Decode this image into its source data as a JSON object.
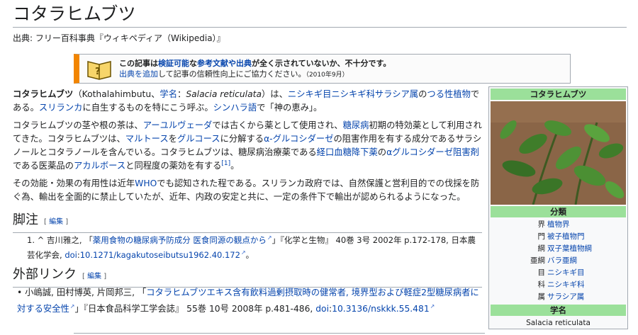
{
  "article": {
    "title": "コタラヒムブツ",
    "from": "出典: フリー百科事典『ウィキペディア（Wikipedia）』"
  },
  "ambox": {
    "l1_a": "この記事は",
    "l1_b": "検証可能",
    "l1_c": "な",
    "l1_d": "参考文献や出典",
    "l1_e": "が全く示されていないか、不十分です。",
    "l2_a": "出典を追加",
    "l2_b": "して記事の信頼性向上にご協力ください。",
    "l2_c": "（2010年9月）"
  },
  "intro": {
    "p1": [
      {
        "t": "コタラヒムブツ",
        "b": true
      },
      {
        "t": "（Kothalahimbutu、"
      },
      {
        "t": "学名",
        "link": true
      },
      {
        "t": "：",
        "i": false
      },
      {
        "t": "Salacia reticulata",
        "i": true
      },
      {
        "t": "）は、"
      },
      {
        "t": "ニシキギ目ニシキギ科サラシア属",
        "link": true
      },
      {
        "t": "の"
      },
      {
        "t": "つる性植物",
        "link": true
      },
      {
        "t": "である。"
      },
      {
        "t": "スリランカ",
        "link": true
      },
      {
        "t": "に自生するものを特にこう呼ぶ。"
      },
      {
        "t": "シンハラ語",
        "link": true
      },
      {
        "t": "で「神の恵み」。"
      }
    ],
    "p2": [
      {
        "t": "コタラヒムブツの茎や根の茶は、"
      },
      {
        "t": "アーユルヴェーダ",
        "link": true
      },
      {
        "t": "では古くから薬として使用され、"
      },
      {
        "t": "糖尿病",
        "link": true
      },
      {
        "t": "初期の特効薬として利用されてきた。コタラヒムブツは、"
      },
      {
        "t": "マルトース",
        "link": true
      },
      {
        "t": "を"
      },
      {
        "t": "グルコース",
        "link": true
      },
      {
        "t": "に分解する"
      },
      {
        "t": "α-グルコシダーゼ",
        "link": true
      },
      {
        "t": "の阻害作用を有する成分であるサラシノールとコタラノールを含んでいる。コタラヒムブツは、糖尿病治療薬である"
      },
      {
        "t": "経口血糖降下薬",
        "link": true
      },
      {
        "t": "の"
      },
      {
        "t": "αグルコシダーゼ阻害剤",
        "link": true
      },
      {
        "t": "である医薬品の"
      },
      {
        "t": "アカルボース",
        "link": true
      },
      {
        "t": "と同程度の薬効を有する"
      },
      {
        "t": "[1]",
        "link": true,
        "sup": true
      },
      {
        "t": "。"
      }
    ],
    "p3": [
      {
        "t": "その効能・効果の有用性は近年"
      },
      {
        "t": "WHO",
        "link": true
      },
      {
        "t": "でも認知された程である。スリランカ政府では、自然保護と営利目的での伐採を防ぐ為、輸出を全面的に禁止していたが、近年、内政の安定と共に、一定の条件下で輸出が認められるようになった。"
      }
    ]
  },
  "sections": {
    "notes_title": "脚注",
    "ext_title": "外部リンク",
    "edit_open": "[",
    "edit_label": "編集",
    "edit_close": "]"
  },
  "notes": [
    [
      {
        "t": "1. ^ "
      },
      {
        "t": "吉川雅之, 「"
      },
      {
        "t": "薬用食物の糖尿病予防成分 医食同源の観点から",
        "link": true,
        "ext": true
      },
      {
        "t": "」『化学と生物』 40巻 3号 2002年 p.172-178, 日本農芸化学会, "
      },
      {
        "t": "doi",
        "link": true
      },
      {
        "t": ":"
      },
      {
        "t": "10.1271/kagakutoseibutsu1962.40.172",
        "link": true,
        "ext": true
      },
      {
        "t": "。"
      }
    ]
  ],
  "ext_links": [
    [
      {
        "t": "• 小嶋誠, 田村博英, 片岡邦三, 「"
      },
      {
        "t": "コタラヒムブツエキス含有飲料過剰摂取時の健常者, 境界型および軽症2型糖尿病者に対する安全性",
        "link": true,
        "ext": true
      },
      {
        "t": "」『日本食品科学工学会誌』 55巻 10号 2008年 p.481-486, "
      },
      {
        "t": "doi",
        "link": true
      },
      {
        "t": ":"
      },
      {
        "t": "10.3136/nskkk.55.481",
        "link": true,
        "ext": true
      }
    ]
  ],
  "infobox": {
    "title": "コタラヒムブツ",
    "class_header": "分類",
    "rows": [
      {
        "k": "界",
        "v": "植物界"
      },
      {
        "k": "門",
        "v": "被子植物門"
      },
      {
        "k": "綱",
        "v": "双子葉植物綱"
      },
      {
        "k": "亜綱",
        "v": "バラ亜綱"
      },
      {
        "k": "目",
        "v": "ニシキギ目"
      },
      {
        "k": "科",
        "v": "ニシキギ科"
      },
      {
        "k": "属",
        "v": "サラシア属"
      }
    ],
    "sci_header": "学名",
    "sci_name": "Salacia reticulata"
  },
  "colors": {
    "link": "#0645ad",
    "infobox_header": "#9be09a",
    "ambox_border": "#f28500"
  }
}
